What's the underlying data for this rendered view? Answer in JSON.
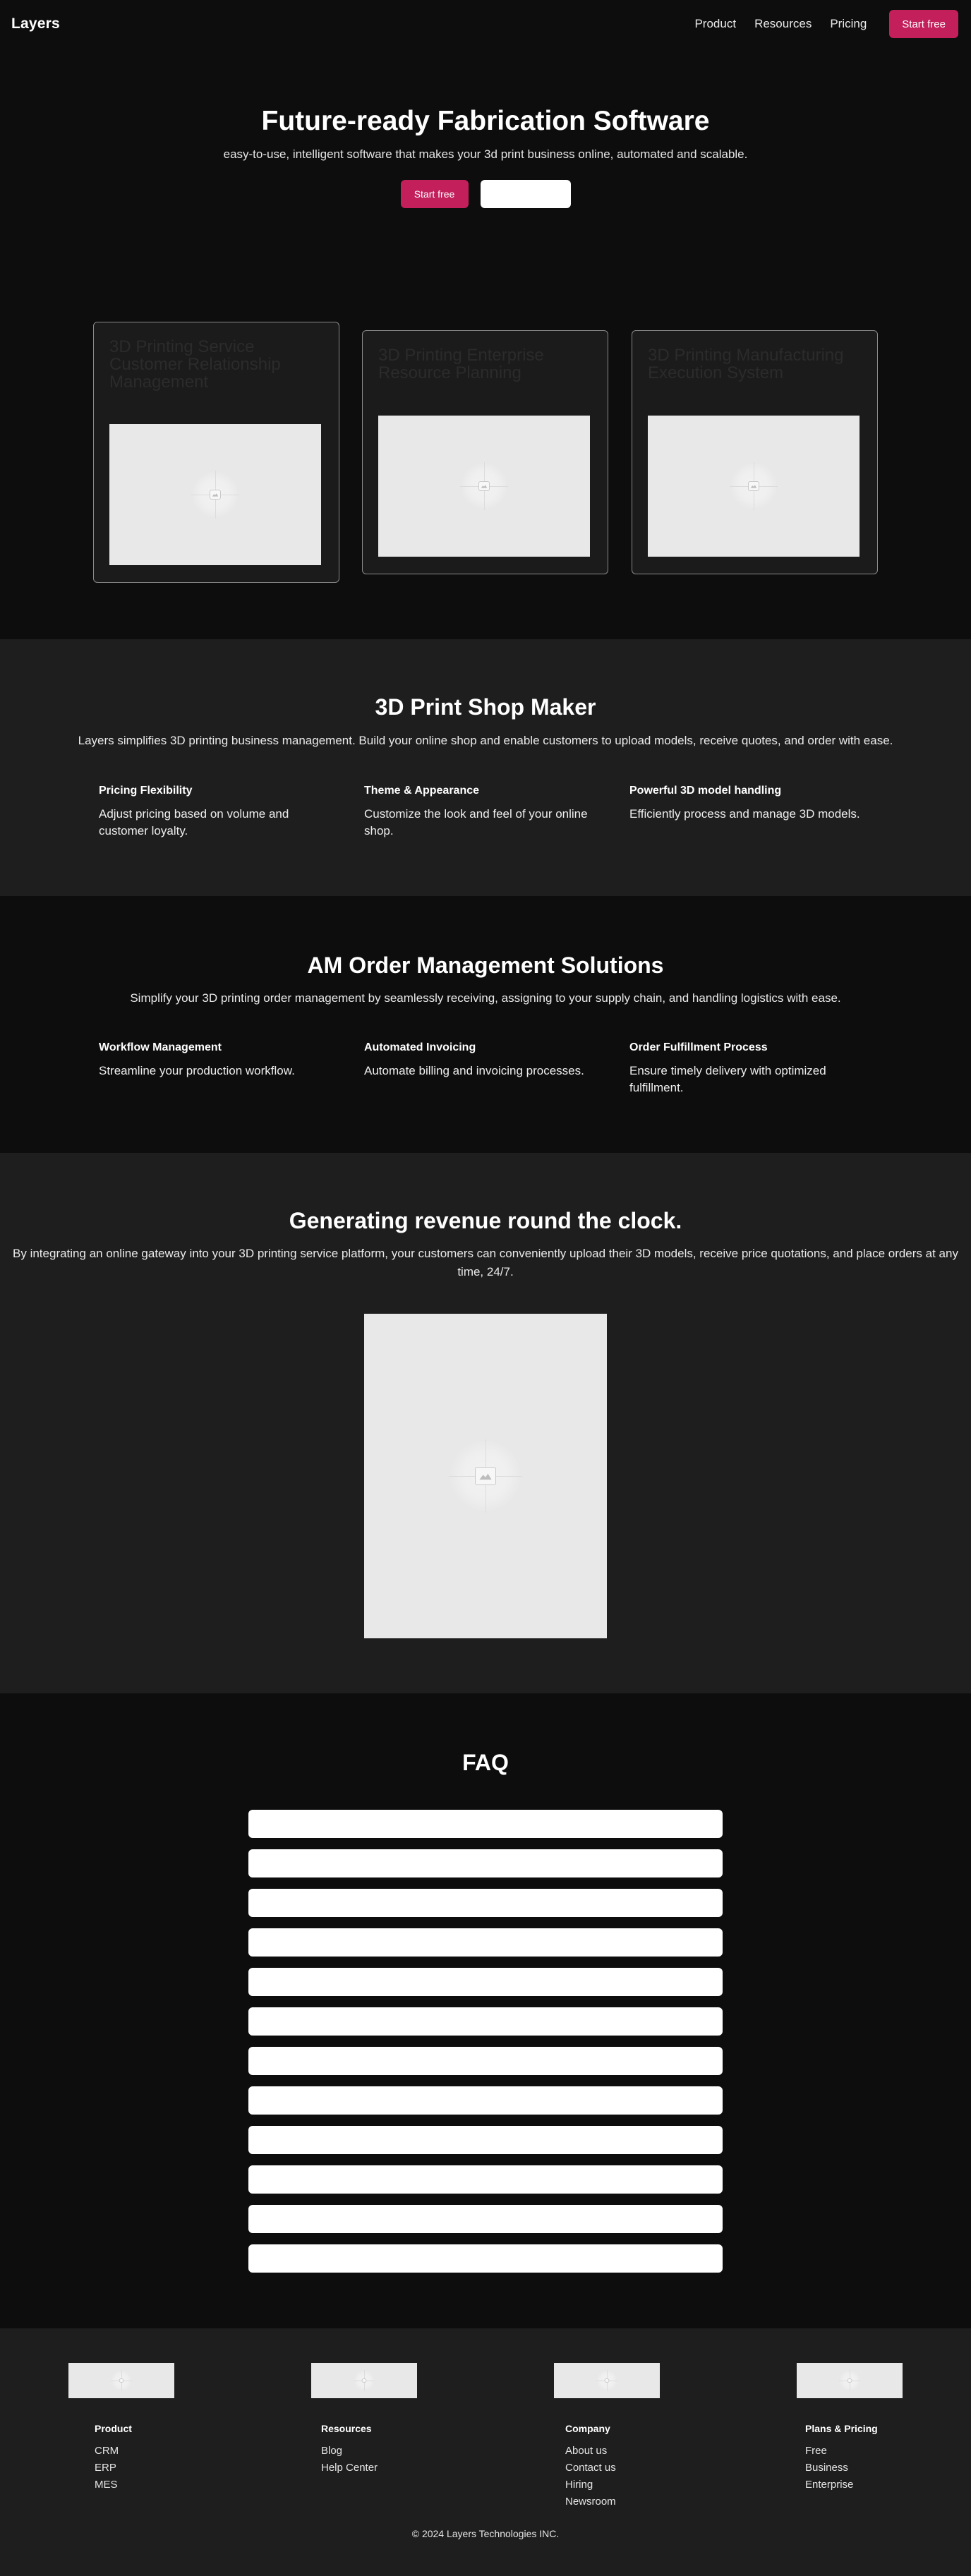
{
  "nav": {
    "logo": "Layers",
    "links": [
      "Product",
      "Resources",
      "Pricing"
    ],
    "cta": "Start free"
  },
  "hero": {
    "title": "Future-ready Fabrication Software",
    "subtitle": "easy-to-use, intelligent software that makes your 3d print business online, automated and scalable.",
    "primary_button": "Start free",
    "secondary_button": ""
  },
  "products": [
    {
      "title": "3D Printing Service Customer Relationship Management"
    },
    {
      "title": "3D Printing Enterprise Resource Planning"
    },
    {
      "title": "3D Printing Manufacturing Execution System"
    }
  ],
  "shop_maker": {
    "title": "3D Print Shop Maker",
    "subtitle": "Layers simplifies 3D printing business management. Build your online shop and enable customers to upload models, receive quotes, and order with ease.",
    "features": [
      {
        "title": "Pricing Flexibility",
        "text": "Adjust pricing based on volume and customer loyalty."
      },
      {
        "title": "Theme & Appearance",
        "text": "Customize the look and feel of your online shop."
      },
      {
        "title": "Powerful 3D model handling",
        "text": "Efficiently process and manage 3D models."
      }
    ]
  },
  "order_mgmt": {
    "title": "AM Order Management Solutions",
    "subtitle": "Simplify your 3D printing order management by seamlessly receiving, assigning to your supply chain, and handling logistics with ease.",
    "features": [
      {
        "title": "Workflow Management",
        "text": "Streamline your production workflow."
      },
      {
        "title": "Automated Invoicing",
        "text": "Automate billing and invoicing processes."
      },
      {
        "title": "Order Fulfillment Process",
        "text": "Ensure timely delivery with optimized fulfillment."
      }
    ]
  },
  "revenue": {
    "title": "Generating revenue round the clock.",
    "subtitle": "By integrating an online gateway into your 3D printing service platform, your customers can conveniently upload their 3D models, receive price quotations, and place orders at any time, 24/7."
  },
  "faq": {
    "title": "FAQ",
    "items": [
      "",
      "",
      "",
      "",
      "",
      "",
      "",
      "",
      "",
      "",
      "",
      ""
    ]
  },
  "footer": {
    "columns": [
      {
        "title": "Product",
        "links": [
          "CRM",
          "ERP",
          "MES"
        ]
      },
      {
        "title": "Resources",
        "links": [
          "Blog",
          "Help Center"
        ]
      },
      {
        "title": "Company",
        "links": [
          "About us",
          "Contact us",
          "Hiring",
          "Newsroom"
        ]
      },
      {
        "title": "Plans & Pricing",
        "links": [
          "Free",
          "Business",
          "Enterprise"
        ]
      }
    ],
    "copyright": "© 2024 Layers Technologies INC."
  },
  "colors": {
    "accent": "#c21f5b",
    "background_dark": "#0d0d0d",
    "background_alt": "#1e1e1e",
    "placeholder": "#e8e8e8"
  },
  "icons": [
    "image-placeholder-icon"
  ]
}
